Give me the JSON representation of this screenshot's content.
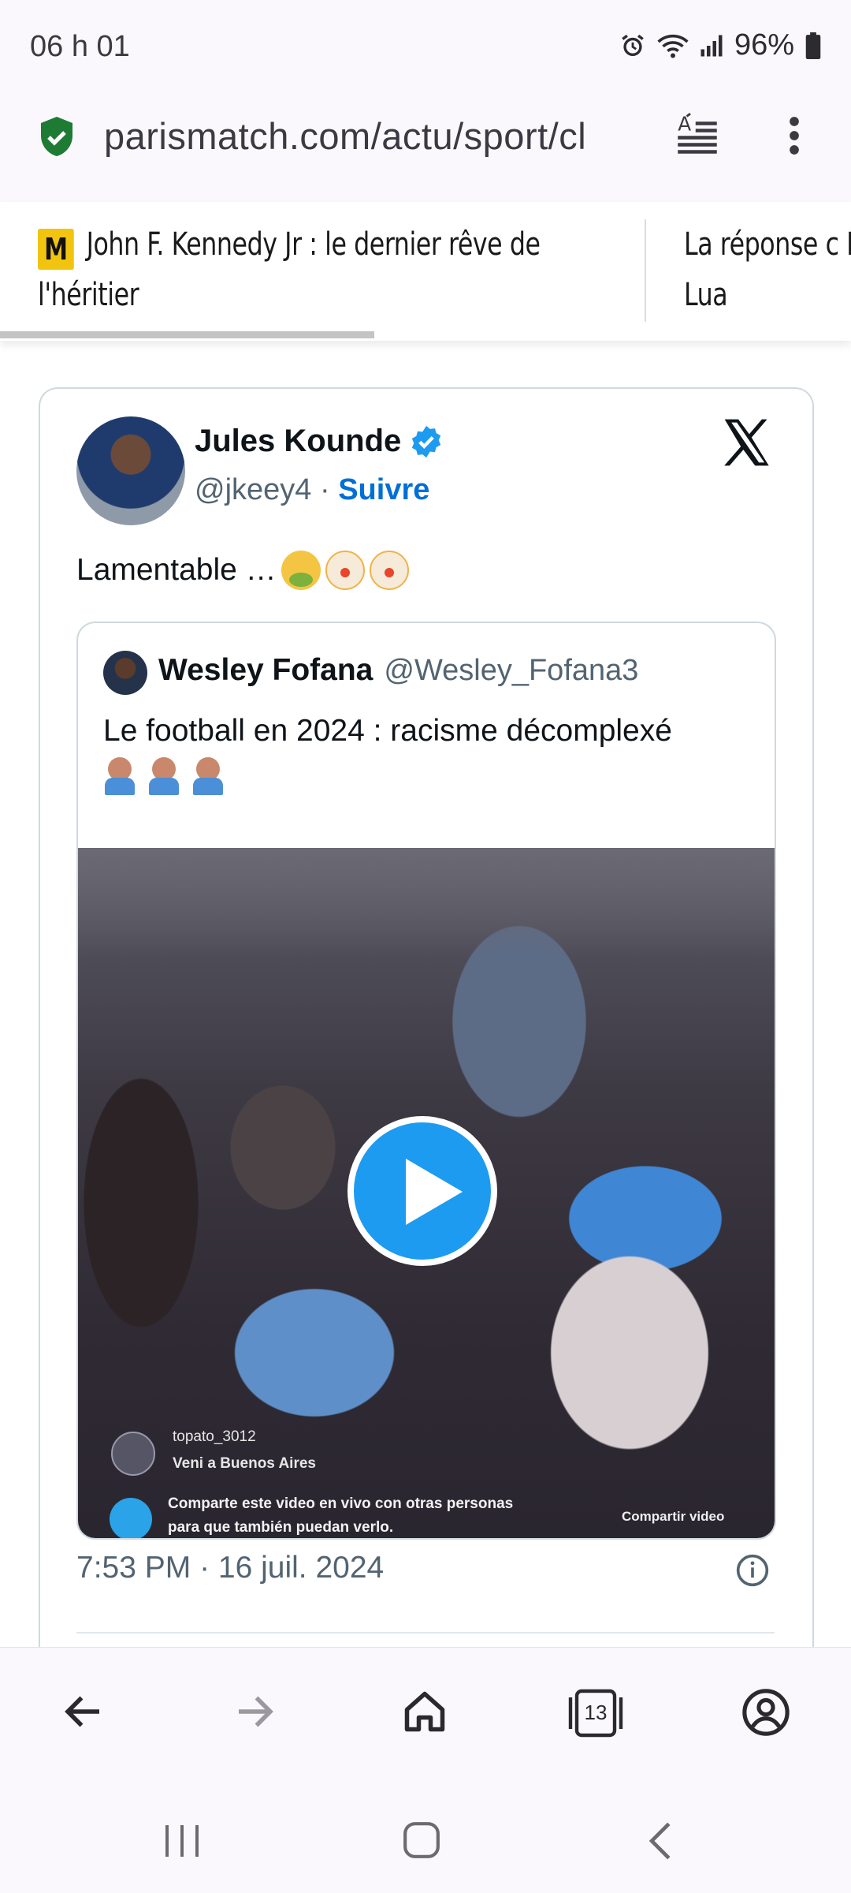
{
  "status_bar": {
    "time": "06 h 01",
    "battery": "96%",
    "icons": [
      "alarm-icon",
      "wifi-icon",
      "signal-icon",
      "battery-icon"
    ]
  },
  "browser": {
    "url": "parismatch.com/actu/sport/cl",
    "secure_icon": "shield-check-icon",
    "colors": {
      "secure": "#1e7b34",
      "link": "#006fd6",
      "play": "#1d9bf0"
    }
  },
  "carousel": {
    "items": [
      {
        "badge": "M",
        "title": "John F. Kennedy Jr : le dernier rêve de l'héritier"
      },
      {
        "title": "La réponse c Match et Lua"
      }
    ],
    "progress_fraction": 0.44
  },
  "tweet": {
    "author": "Jules Kounde",
    "handle": "@jkeey4",
    "separator": "·",
    "follow": "Suivre",
    "text": "Lamentable …",
    "emojis": [
      "nauseated-face-emoji",
      "clown-face-emoji",
      "clown-face-emoji"
    ],
    "quote": {
      "author": "Wesley Fofana",
      "handle": "@Wesley_Fofana3",
      "text": "Le football en 2024 : racisme décomplexé",
      "emojis": [
        "person-facepalming-emoji",
        "person-facepalming-emoji",
        "person-facepalming-emoji"
      ],
      "video": {
        "live_user": "topato_3012",
        "live_comment": "Veni a Buenos Aires",
        "share_line1": "Comparte este video en vivo con otras personas",
        "share_line2": "para que también puedan verlo.",
        "share_button": "Compartir video"
      }
    },
    "timestamp": "7:53 PM · 16 juil. 2024"
  },
  "toolbar": {
    "tab_count": "13"
  }
}
